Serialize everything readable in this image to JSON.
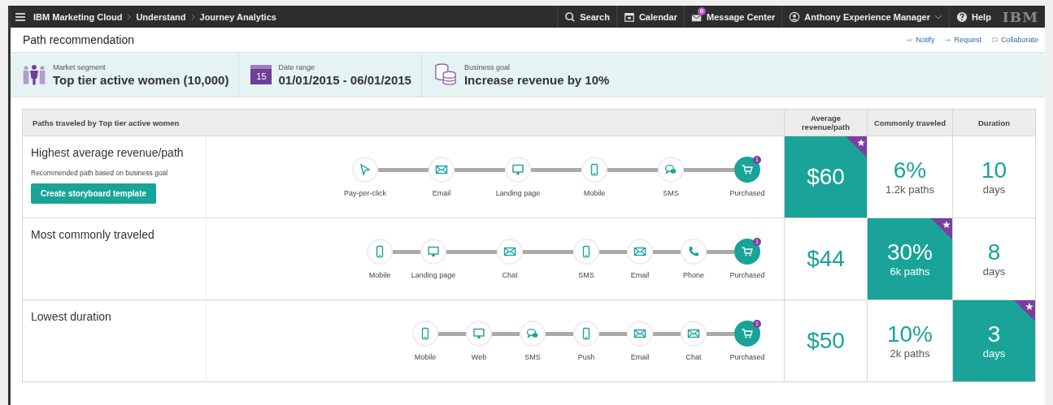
{
  "top_bar": {
    "breadcrumbs": [
      "IBM Marketing Cloud",
      "Understand",
      "Journey Analytics"
    ],
    "actions": [
      {
        "kind": "search",
        "label": "Search"
      },
      {
        "kind": "calendar",
        "label": "Calendar"
      },
      {
        "kind": "message",
        "label": "Message Center",
        "badge": "0"
      },
      {
        "kind": "user",
        "label": "Anthony Experience Manager"
      },
      {
        "kind": "help",
        "label": "Help"
      }
    ],
    "logo": "IBM"
  },
  "page_title": "Path recommendation",
  "page_links": [
    {
      "kind": "notify",
      "label": "Notify"
    },
    {
      "kind": "request",
      "label": "Request"
    },
    {
      "kind": "collaborate",
      "label": "Collaborate"
    }
  ],
  "context": [
    {
      "kind": "segment",
      "label": "Market segment",
      "value": "Top tier active women (10,000)"
    },
    {
      "kind": "date",
      "label": "Date range",
      "value": "01/01/2015 - 06/01/2015",
      "icon_text": "15"
    },
    {
      "kind": "goal",
      "label": "Business goal",
      "value": "Increase revenue by 10%"
    }
  ],
  "table": {
    "title": "Paths traveled by Top tier active women",
    "columns": [
      "Average revenue/path",
      "Commonly traveled",
      "Duration"
    ],
    "rows": [
      {
        "title": "Highest average revenue/path",
        "note": "Recommended path based on business goal",
        "button": "Create storyboard template",
        "steps": [
          {
            "kind": "click",
            "label": "Pay-per-click",
            "long_link": true
          },
          {
            "kind": "email",
            "label": "Email",
            "long_link": true
          },
          {
            "kind": "monitor",
            "label": "Landing page",
            "long_link": true
          },
          {
            "kind": "mobile",
            "label": "Mobile",
            "long_link": true
          },
          {
            "kind": "sms",
            "label": "SMS",
            "long_link": true
          },
          {
            "kind": "cart",
            "label": "Purchased",
            "badge": "1"
          }
        ],
        "metrics": [
          {
            "value": "$60",
            "highlighted": true
          },
          {
            "value": "6%",
            "sub": "1.2k paths",
            "highlighted": false
          },
          {
            "value": "10",
            "sub": "days",
            "highlighted": false
          }
        ]
      },
      {
        "title": "Most commonly traveled",
        "steps": [
          {
            "kind": "mobile",
            "label": "Mobile",
            "long_link": false
          },
          {
            "kind": "monitor",
            "label": "Landing page",
            "long_link": true
          },
          {
            "kind": "email",
            "label": "Chat",
            "long_link": true
          },
          {
            "kind": "mobile",
            "label": "SMS",
            "long_link": false
          },
          {
            "kind": "email",
            "label": "Email",
            "long_link": false
          },
          {
            "kind": "phone",
            "label": "Phone",
            "long_link": false
          },
          {
            "kind": "cart",
            "label": "Purchased",
            "badge": "1"
          }
        ],
        "metrics": [
          {
            "value": "$44",
            "highlighted": false
          },
          {
            "value": "30%",
            "sub": "6k paths",
            "highlighted": true
          },
          {
            "value": "8",
            "sub": "days",
            "highlighted": false
          }
        ]
      },
      {
        "title": "Lowest duration",
        "steps": [
          {
            "kind": "mobile",
            "label": "Mobile",
            "long_link": false
          },
          {
            "kind": "monitor",
            "label": "Web",
            "long_link": false
          },
          {
            "kind": "sms",
            "label": "SMS",
            "long_link": false
          },
          {
            "kind": "mobile",
            "label": "Push",
            "long_link": false
          },
          {
            "kind": "email",
            "label": "Email",
            "long_link": false
          },
          {
            "kind": "email",
            "label": "Chat",
            "long_link": false
          },
          {
            "kind": "cart",
            "label": "Purchased",
            "badge": "1"
          }
        ],
        "metrics": [
          {
            "value": "$50",
            "highlighted": false
          },
          {
            "value": "10%",
            "sub": "2k paths",
            "highlighted": false
          },
          {
            "value": "3",
            "sub": "days",
            "highlighted": true
          }
        ]
      }
    ]
  }
}
